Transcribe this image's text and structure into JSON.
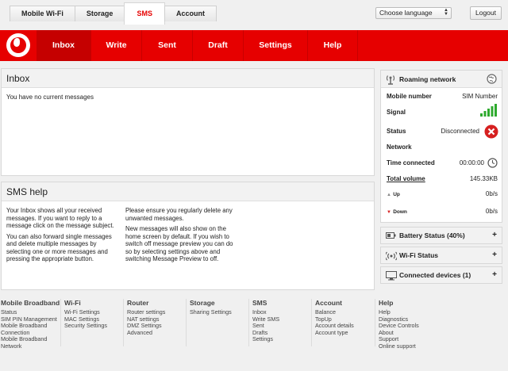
{
  "top_tabs": [
    {
      "label": "Mobile Wi-Fi"
    },
    {
      "label": "Storage"
    },
    {
      "label": "SMS"
    },
    {
      "label": "Account"
    }
  ],
  "language_select": {
    "value": "Choose language"
  },
  "logout_label": "Logout",
  "nav": [
    "Inbox",
    "Write",
    "Sent",
    "Draft",
    "Settings",
    "Help"
  ],
  "inbox": {
    "title": "Inbox",
    "empty_message": "You have no current messages"
  },
  "sms_help": {
    "title": "SMS help",
    "left": [
      "Your Inbox shows all your received messages. If you want to reply to a message click on the message subject.",
      "You can also forward single messages and delete multiple messages by selecting one or more messages and pressing the appropriate button."
    ],
    "right": [
      "Please ensure you regularly delete any unwanted messages.",
      "New messages will also show on the home screen by default. If you wish to switch off message preview you can do so by selecting settings above and switching Message Preview to off."
    ]
  },
  "network_panel": {
    "title": "Roaming network",
    "mobile_number_label": "Mobile number",
    "mobile_number_value": "SIM Number",
    "signal_label": "Signal",
    "signal_bars": 5,
    "status_label": "Status",
    "status_value": "Disconnected",
    "network_label": "Network",
    "time_label": "Time connected",
    "time_value": "00:00:00",
    "total_label": "Total volume",
    "total_value": "145.33KB",
    "up_label": "Up",
    "up_value": "0b/s",
    "down_label": "Down",
    "down_value": "0b/s"
  },
  "accordions": [
    {
      "title": "Battery Status (40%)",
      "icon": "battery-icon"
    },
    {
      "title": "Wi-Fi Status",
      "icon": "wifi-icon"
    },
    {
      "title": "Connected devices (1)",
      "icon": "monitor-icon"
    }
  ],
  "footer": [
    {
      "heading": "Mobile Broadband",
      "links": [
        "Status",
        "SIM PIN Management",
        "Mobile Broadband",
        "Connection",
        "Mobile Broadband",
        "Network"
      ]
    },
    {
      "heading": "Wi-Fi",
      "links": [
        "Wi-Fi Settings",
        "MAC Settings",
        "Security Settings"
      ]
    },
    {
      "heading": "Router",
      "links": [
        "Router settings",
        "NAT settings",
        "DMZ Settings",
        "Advanced"
      ]
    },
    {
      "heading": "Storage",
      "links": [
        "Sharing Settings"
      ]
    },
    {
      "heading": "SMS",
      "links": [
        "Inbox",
        "Write SMS",
        "Sent",
        "Drafts",
        "Settings"
      ]
    },
    {
      "heading": "Account",
      "links": [
        "Balance",
        "TopUp",
        "Account details",
        "Account type"
      ]
    },
    {
      "heading": "Help",
      "links": [
        "Help",
        "Diagnostics",
        "Device Controls",
        "About",
        "Support",
        "Online support"
      ]
    }
  ],
  "colors": {
    "brand_red": "#e60000",
    "signal_green": "#2eaa2e",
    "status_red": "#d62020"
  }
}
